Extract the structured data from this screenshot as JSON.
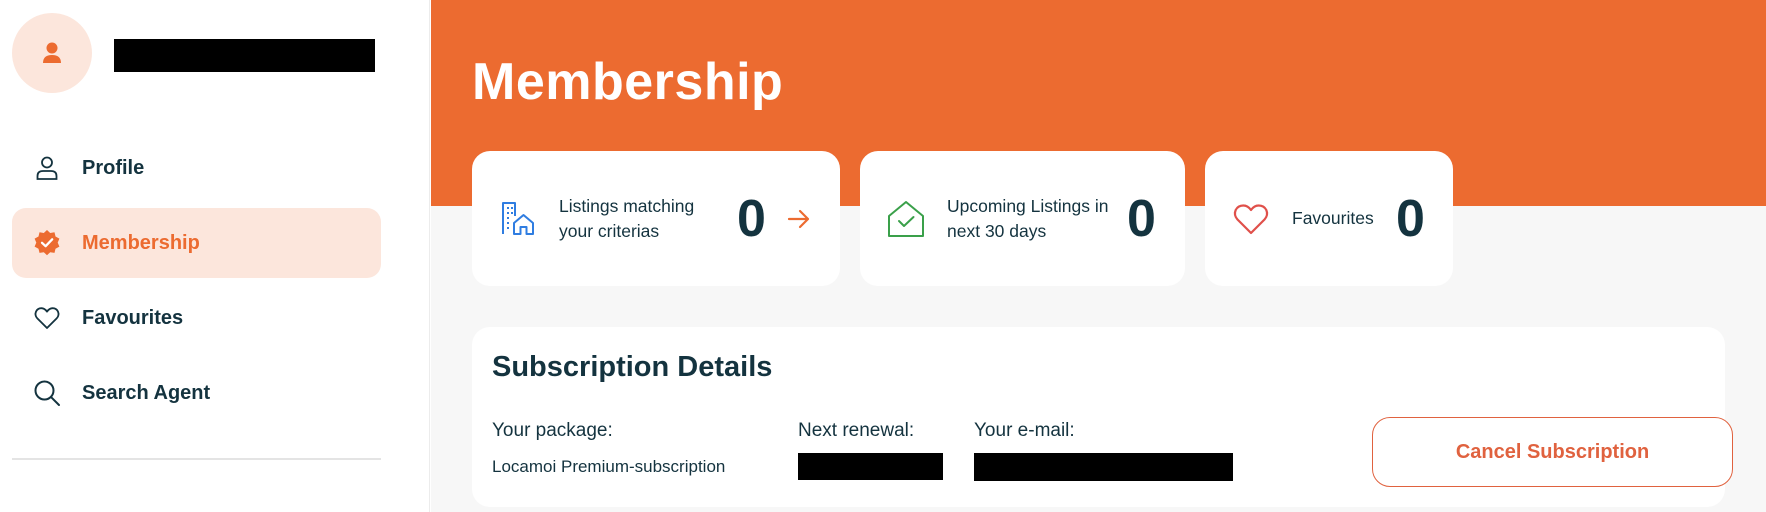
{
  "colors": {
    "accent": "#ec6b30",
    "accent_soft": "#fce6dc",
    "text_dark": "#14333f",
    "blue_icon": "#2f7de1",
    "green_icon": "#3aa04a",
    "red_icon": "#e0504a",
    "cancel": "#e0623f"
  },
  "user": {
    "avatar_icon": "user-icon"
  },
  "sidebar": {
    "items": [
      {
        "label": "Profile",
        "icon": "user-outline-icon",
        "active": false
      },
      {
        "label": "Membership",
        "icon": "badge-check-icon",
        "active": true
      },
      {
        "label": "Favourites",
        "icon": "heart-icon",
        "active": false
      },
      {
        "label": "Search Agent",
        "icon": "search-icon",
        "active": false
      }
    ]
  },
  "main": {
    "title": "Membership",
    "stats": [
      {
        "label": "Listings matching your criterias",
        "count": "0",
        "icon": "buildings-icon",
        "has_arrow": true
      },
      {
        "label": "Upcoming Listings in next 30 days",
        "count": "0",
        "icon": "house-check-icon",
        "has_arrow": false
      },
      {
        "label": "Favourites",
        "count": "0",
        "icon": "heart-icon",
        "has_arrow": false
      }
    ],
    "subscription": {
      "title": "Subscription Details",
      "package_label": "Your package:",
      "package_value": "Locamoi Premium-subscription",
      "renewal_label": "Next renewal:",
      "email_label": "Your e-mail:",
      "cancel_label": "Cancel Subscription"
    }
  }
}
